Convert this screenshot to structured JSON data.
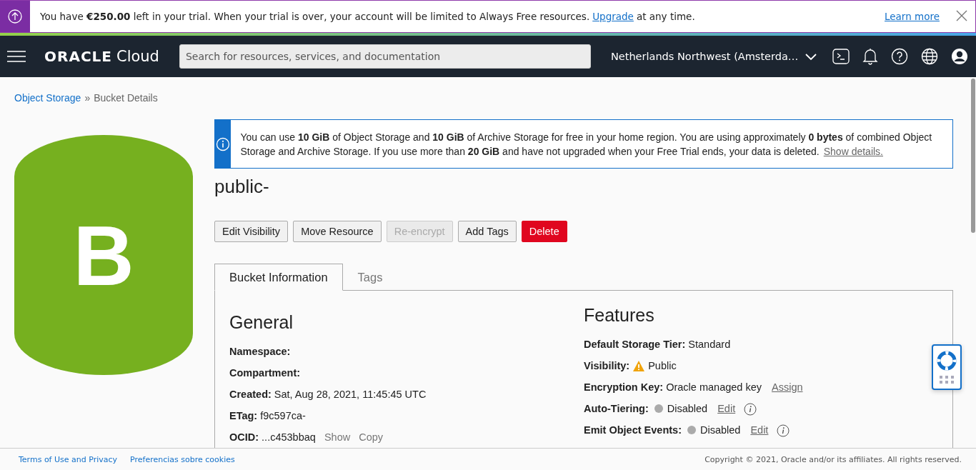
{
  "trial_banner": {
    "text_before": "You have **€250.00** left in your trial. When your trial is over, your account will be limited to Always Free resources.",
    "link": "Upgrade",
    "text_after": "at any time.",
    "learn_more": "Learn more"
  },
  "navbar": {
    "logo_brand": "ORACLE",
    "logo_product": "Cloud",
    "search": {
      "placeholder": "Search for resources, services, and documentation"
    },
    "region": "Netherlands Northwest (Amsterda…"
  },
  "breadcrumb": [
    {
      "label": "Object Storage",
      "kind": "link"
    },
    {
      "label": "»",
      "kind": "separator"
    },
    {
      "label": "Bucket Details",
      "kind": "current"
    }
  ],
  "bucket_icon": {
    "letter": "B"
  },
  "info_notice": {
    "text": "You can use **10 GiB** of Object Storage and **10 GiB** of Archive Storage for free in your home region. You are using approximately **0 bytes** of combined Object Storage and Archive Storage. If you use more than **20 GiB** and have not upgraded when your Free Trial ends, your data is deleted.",
    "link": "Show details."
  },
  "bucket_name": "public-",
  "actions": [
    {
      "label": "Edit Visibility",
      "kind": "default"
    },
    {
      "label": "Move Resource",
      "kind": "default"
    },
    {
      "label": "Re-encrypt",
      "kind": "disabled"
    },
    {
      "label": "Add Tags",
      "kind": "default"
    },
    {
      "label": "Delete",
      "kind": "danger"
    }
  ],
  "tabs": [
    {
      "label": "Bucket Information",
      "selected": true
    },
    {
      "label": "Tags",
      "selected": false
    }
  ],
  "general": {
    "title": "General",
    "rows": [
      {
        "label": "Namespace:"
      },
      {
        "label": "Compartment:"
      },
      {
        "label": "Created:",
        "value": "Sat, Aug 28, 2021, 11:45:45 UTC"
      },
      {
        "label": "ETag:",
        "value": "f9c597ca-"
      },
      {
        "label": "OCID:",
        "value": "...c453bbaq",
        "links": [
          "Show",
          "Copy"
        ]
      }
    ]
  },
  "features": {
    "title": "Features",
    "rows": [
      {
        "kind": "plain",
        "label": "Default Storage Tier:",
        "value": "Standard"
      },
      {
        "kind": "warning",
        "label": "Visibility:",
        "value": "Public"
      },
      {
        "kind": "link",
        "label": "Encryption Key:",
        "value": "Oracle managed key",
        "link": "Assign"
      },
      {
        "kind": "status",
        "label": "Auto-Tiering:",
        "enabled": false,
        "value": "Disabled",
        "link": "Edit"
      },
      {
        "kind": "status",
        "label": "Emit Object Events:",
        "enabled": false,
        "value": "Disabled",
        "link": "Edit"
      }
    ]
  },
  "footer": {
    "links": [
      "Terms of Use and Privacy",
      "Preferencias sobre cookies"
    ],
    "copyright": "Copyright © 2021, Oracle and/or its affiliates. All rights reserved."
  }
}
